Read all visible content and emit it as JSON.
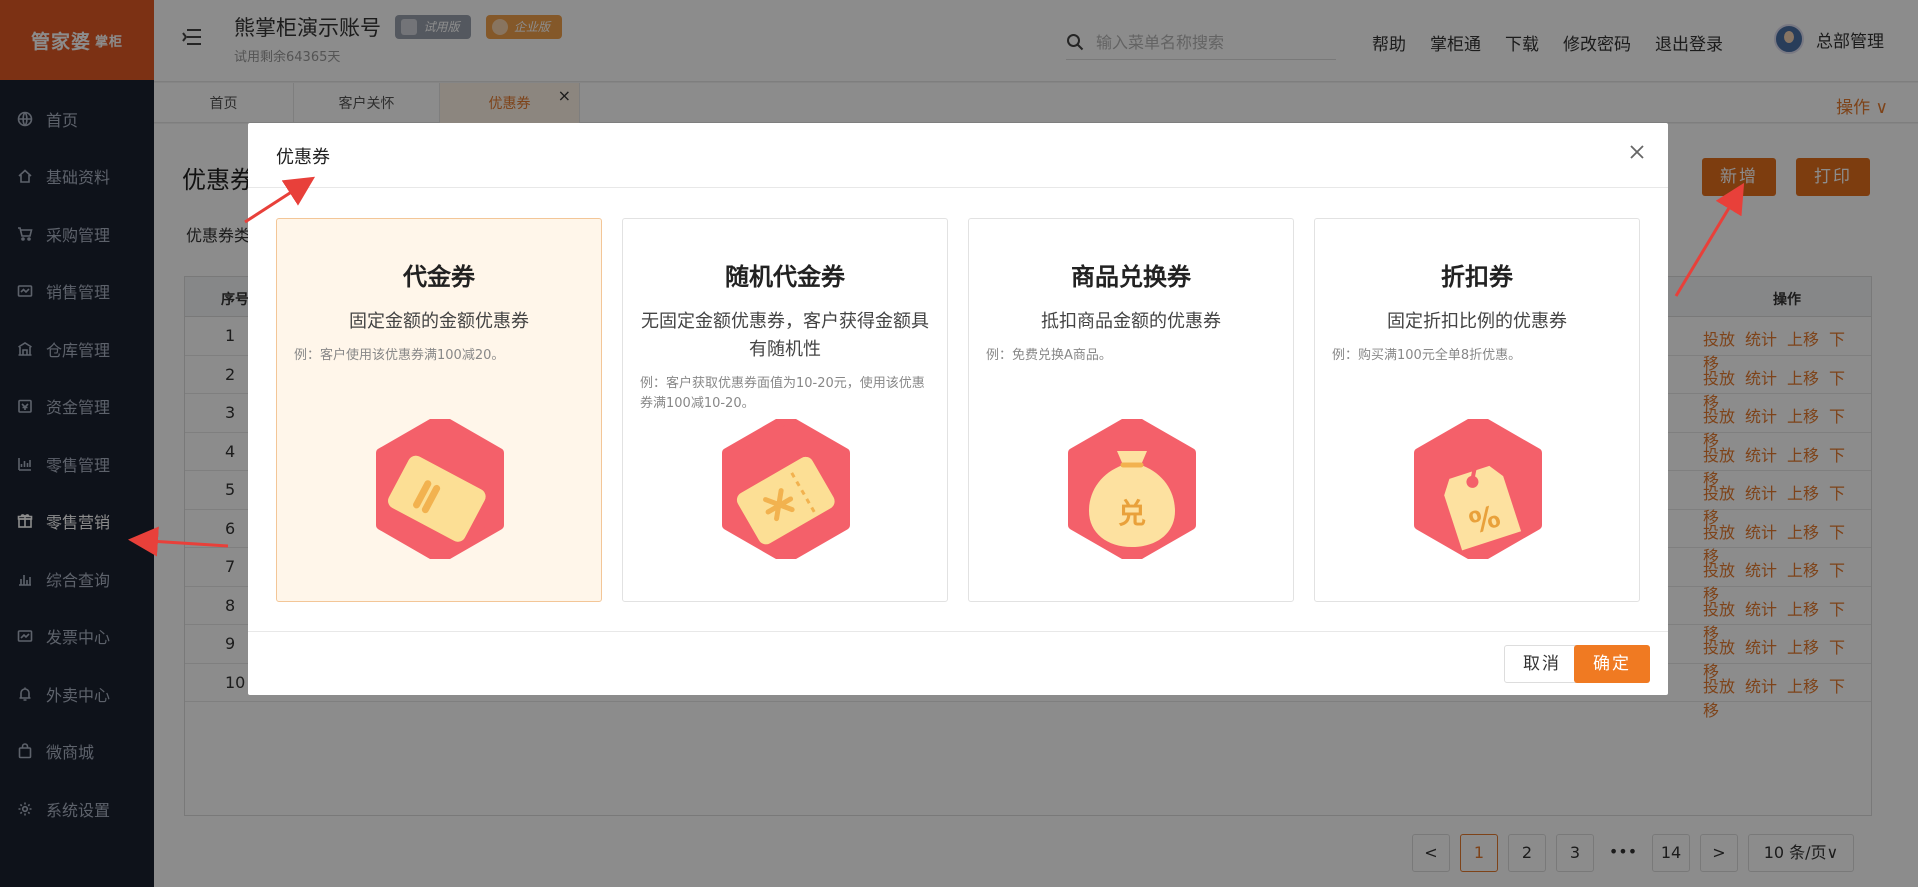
{
  "app": {
    "logo_main": "管家婆",
    "logo_sub": "掌柜",
    "brand_color": "#e25a26",
    "accent_color": "#f07a22"
  },
  "sidebar": {
    "items": [
      {
        "label": "首页",
        "icon": "globe-icon"
      },
      {
        "label": "基础资料",
        "icon": "home-icon"
      },
      {
        "label": "采购管理",
        "icon": "cart-icon"
      },
      {
        "label": "销售管理",
        "icon": "sales-icon"
      },
      {
        "label": "仓库管理",
        "icon": "warehouse-icon"
      },
      {
        "label": "资金管理",
        "icon": "fund-icon"
      },
      {
        "label": "零售管理",
        "icon": "chart-icon"
      },
      {
        "label": "零售营销",
        "icon": "gift-icon",
        "active": true
      },
      {
        "label": "综合查询",
        "icon": "bar-chart-icon"
      },
      {
        "label": "发票中心",
        "icon": "invoice-icon"
      },
      {
        "label": "外卖中心",
        "icon": "bell-icon"
      },
      {
        "label": "微商城",
        "icon": "bag-icon"
      },
      {
        "label": "系统设置",
        "icon": "gear-icon"
      }
    ]
  },
  "header": {
    "account_name": "熊掌柜演示账号",
    "trial_badge": "试用版",
    "edition_badge": "企业版",
    "trial_remaining": "试用剩余64365天",
    "search_placeholder": "输入菜单名称搜索",
    "links": [
      "帮助",
      "掌柜通",
      "下载",
      "修改密码",
      "退出登录"
    ],
    "user_name": "总部管理"
  },
  "tabs": {
    "items": [
      "首页",
      "客户关怀",
      "优惠券"
    ],
    "close": "×",
    "operations": "操作 ∨"
  },
  "main": {
    "title": "优惠券",
    "filter_label": "优惠券类",
    "add_button": "新增",
    "print_button": "打印",
    "col_no": "序号",
    "col_ops": "操作",
    "rows": [
      "1",
      "2",
      "3",
      "4",
      "5",
      "6",
      "7",
      "8",
      "9",
      "10"
    ],
    "row_actions": [
      "投放",
      "统计",
      "上移",
      "下移"
    ],
    "pagination": {
      "prev": "<",
      "pages": [
        "1",
        "2",
        "3"
      ],
      "ellipsis": "•••",
      "last": "14",
      "next": ">",
      "page_size": "10 条/页∨"
    }
  },
  "dialog": {
    "title": "优惠券",
    "cards": [
      {
        "title": "代金券",
        "desc": "固定金额的金额优惠券",
        "example": "例：客户使用该优惠券满100减20。",
        "icon": "cash-voucher-icon",
        "selected": true
      },
      {
        "title": "随机代金券",
        "desc": "无固定金额优惠券，客户获得金额具有随机性",
        "example": "例：客户获取优惠券面值为10-20元，使用该优惠券满100减10-20。",
        "icon": "random-voucher-icon",
        "selected": false
      },
      {
        "title": "商品兑换券",
        "desc": "抵扣商品金额的优惠券",
        "example": "例：免费兑换A商品。",
        "icon": "exchange-bag-icon",
        "glyph": "兑",
        "selected": false
      },
      {
        "title": "折扣券",
        "desc": "固定折扣比例的优惠券",
        "example": "例：购买满100元全单8折优惠。",
        "icon": "discount-tag-icon",
        "glyph": "%",
        "selected": false
      }
    ],
    "cancel": "取消",
    "ok": "确定"
  }
}
